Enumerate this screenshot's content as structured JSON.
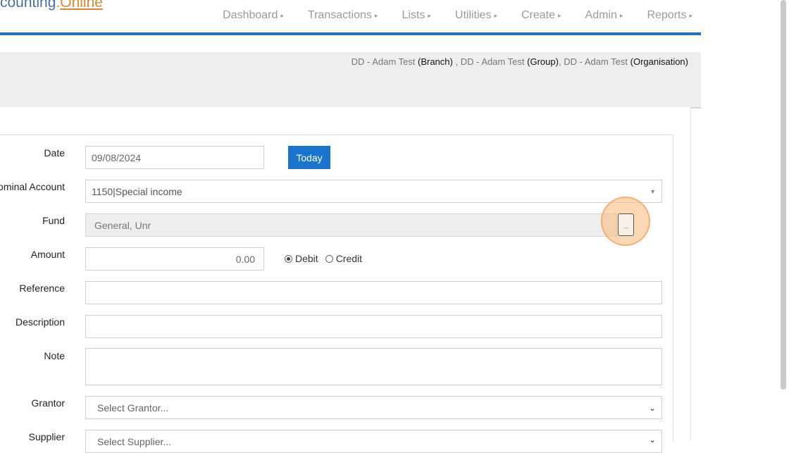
{
  "header": {
    "logo_main": "counting",
    "logo_dot": ".",
    "logo_online": "Online",
    "nav": [
      "Dashboard",
      "Transactions",
      "Lists",
      "Utilities",
      "Create",
      "Admin",
      "Reports"
    ]
  },
  "context": {
    "branch_name": "DD - Adam Test",
    "branch_tag": "(Branch)",
    "sep1": ",",
    "group_name": "DD - Adam Test",
    "group_tag": "(Group)",
    "sep2": ",",
    "org_name": "DD - Adam Test",
    "org_tag": "(Organisation)"
  },
  "form": {
    "date_label": "Date",
    "date_value": "09/08/2024",
    "today_button": "Today",
    "nominal_label": "ominal Account",
    "nominal_value": "1150|Special income",
    "fund_label": "Fund",
    "fund_value": "General, Unr",
    "fund_browse": "...",
    "amount_label": "Amount",
    "amount_value": "0.00",
    "debit_label": "Debit",
    "credit_label": "Credit",
    "reference_label": "Reference",
    "description_label": "Description",
    "note_label": "Note",
    "grantor_label": "Grantor",
    "grantor_placeholder": "Select Grantor...",
    "supplier_label": "Supplier",
    "supplier_placeholder": "Select Supplier..."
  }
}
